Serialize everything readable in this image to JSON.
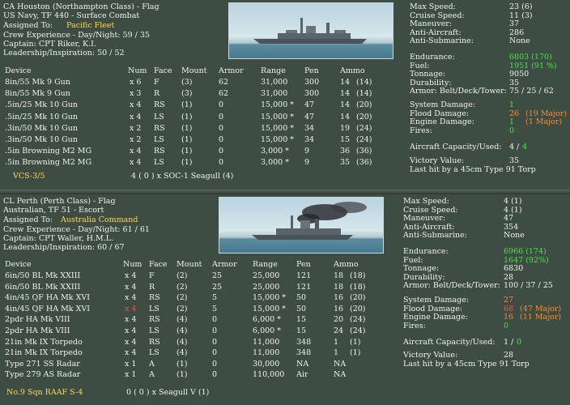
{
  "ship1": {
    "title": "CA Houston (Northampton Class) - Flag",
    "navy": "US Navy, TF 440 - Surface Combat",
    "assigned_label": "Assigned To:",
    "assigned_value": "Pacific Fleet",
    "crew": "Crew Experience - Day/Night:  59 / 35",
    "captain": "Captain:  CPT Riker, K.I.",
    "leadership": "Leadership/Inspiration: 50 / 52",
    "headers": [
      "Device",
      "Num",
      "Face",
      "Mount",
      "Armor",
      "Range",
      "Pen",
      "Ammo"
    ],
    "devices": [
      [
        "8in/55 Mk 9 Gun",
        "x 6",
        "F",
        "(3)",
        "62",
        "31,000",
        "300",
        "14",
        "(14)"
      ],
      [
        "8in/55 Mk 9 Gun",
        "x 3",
        "R",
        "(3)",
        "62",
        "31,000",
        "300",
        "14",
        "(14)"
      ],
      [
        ".5in/25 Mk 10 Gun",
        "x 4",
        "RS",
        "(1)",
        "0",
        "15,000 *",
        "47",
        "14",
        "(20)"
      ],
      [
        ".5in/25 Mk 10 Gun",
        "x 4",
        "LS",
        "(1)",
        "0",
        "15,000 *",
        "47",
        "14",
        "(20)"
      ],
      [
        ".3in/50 Mk 10 Gun",
        "x 2",
        "RS",
        "(1)",
        "0",
        "15,000 *",
        "34",
        "19",
        "(24)"
      ],
      [
        ".3in/50 Mk 10 Gun",
        "x 2",
        "LS",
        "(1)",
        "0",
        "15,000 *",
        "34",
        "15",
        "(24)"
      ],
      [
        ".5in Browning M2 MG",
        "x 4",
        "RS",
        "(1)",
        "0",
        "3,000 *",
        "9",
        "36",
        "(36)"
      ],
      [
        ".5in Browning M2 MG",
        "x 4",
        "LS",
        "(1)",
        "0",
        "3,000 *",
        "9",
        "35",
        "(36)"
      ]
    ],
    "air_unit": "VCS-3/5",
    "air_detail": "4 ( 0 ) x SOC-1 Seagull (4)",
    "stats": [
      {
        "label": "Max Speed:",
        "value": "23 (6)",
        "cls": ""
      },
      {
        "label": "Cruise Speed:",
        "value": "11 (3)",
        "cls": ""
      },
      {
        "label": "Maneuver:",
        "value": "37",
        "cls": ""
      },
      {
        "label": "Anti-Aircraft:",
        "value": "286",
        "cls": ""
      },
      {
        "label": "Anti-Submarine:",
        "value": "None",
        "cls": ""
      }
    ],
    "stats2": [
      {
        "label": "Endurance:",
        "value": "6803 (170)",
        "cls": "green"
      },
      {
        "label": "Fuel:",
        "value": "1951 (91 %)",
        "cls": "green"
      },
      {
        "label": "Tonnage:",
        "value": "9050",
        "cls": ""
      },
      {
        "label": "Durability:",
        "value": "35",
        "cls": ""
      },
      {
        "label": "Armor: Belt/Deck/Tower:",
        "value": "75 / 25 / 62",
        "cls": ""
      }
    ],
    "damage": [
      {
        "label": "System Damage:",
        "value": "1",
        "cls": "green",
        "extra": "",
        "extra_cls": ""
      },
      {
        "label": "Flood Damage:",
        "value": "26",
        "cls": "orange",
        "extra": "(19 Major)",
        "extra_cls": "orange"
      },
      {
        "label": "Engine Damage:",
        "value": "1",
        "cls": "green",
        "extra": "(1 Major)",
        "extra_cls": "orange"
      },
      {
        "label": "Fires:",
        "value": "0",
        "cls": "green",
        "extra": "",
        "extra_cls": ""
      }
    ],
    "aircraft_label": "Aircraft Capacity/Used:",
    "aircraft_value": "4 / ",
    "aircraft_used": "4",
    "victory_label": "Victory Value:",
    "victory_value": "35",
    "last_hit": "Last hit by a      45cm Type 91 Torp"
  },
  "ship2": {
    "title": "CL Perth (Perth Class) - Flag",
    "navy": "Australian, TF 51 - Escort",
    "assigned_label": "Assigned To:",
    "assigned_value": "Australia Command",
    "crew": "Crew Experience - Day/Night: 61 / 61",
    "captain": "Captain:  CPT Waller, H.M.L.",
    "leadership": "Leadership/Inspiration: 60 / 67",
    "headers": [
      "Device",
      "Num",
      "Face",
      "Mount",
      "Armor",
      "Range",
      "Pen",
      "Ammo"
    ],
    "devices": [
      [
        "6in/50 BL Mk XXIII",
        "x 4",
        "F",
        "(2)",
        "25",
        "25,000",
        "121",
        "18",
        "(18)"
      ],
      [
        "6in/50 BL Mk XXIII",
        "x 4",
        "R",
        "(2)",
        "25",
        "25,000",
        "121",
        "18",
        "(18)"
      ],
      [
        "4in/45 QF HA Mk XVI",
        "x 4",
        "RS",
        "(2)",
        "5",
        "15,000 *",
        "50",
        "16",
        "(20)"
      ],
      [
        "4in/45 QF HA Mk XVI",
        "x 4",
        "LS",
        "(2)",
        "5",
        "15,000 *",
        "50",
        "16",
        "(20)"
      ],
      [
        "2pdr HA Mk VIII",
        "x 4",
        "RS",
        "(4)",
        "0",
        "6,000 *",
        "15",
        "20",
        "(24)"
      ],
      [
        "2pdr HA Mk VIII",
        "x 4",
        "LS",
        "(4)",
        "0",
        "6,000 *",
        "15",
        "24",
        "(24)"
      ],
      [
        "21in Mk IX Torpedo",
        "x 4",
        "RS",
        "(4)",
        "0",
        "11,000",
        "348",
        "1",
        "(1)"
      ],
      [
        "21in Mk IX Torpedo",
        "x 4",
        "LS",
        "(4)",
        "0",
        "11,000",
        "348",
        "1",
        "(1)"
      ],
      [
        "Type 271 SS Radar",
        "x 1",
        "A",
        "(1)",
        "0",
        "30,000",
        "NA",
        "NA",
        ""
      ],
      [
        "Type 279 AS Radar",
        "x 1",
        "A",
        "(1)",
        "0",
        "110,000",
        "Air",
        "NA",
        ""
      ]
    ],
    "air_unit": "No.9 Sqn RAAF S-4",
    "air_detail": "0 ( 0 ) x Seagull V (1)",
    "stats": [
      {
        "label": "Max Speed:",
        "value": "4 (1)",
        "cls": ""
      },
      {
        "label": "Cruise Speed:",
        "value": "4 (1)",
        "cls": ""
      },
      {
        "label": "Maneuver:",
        "value": "47",
        "cls": ""
      },
      {
        "label": "Anti-Aircraft:",
        "value": "354",
        "cls": ""
      },
      {
        "label": "Anti-Submarine:",
        "value": "None",
        "cls": ""
      }
    ],
    "stats2": [
      {
        "label": "Endurance:",
        "value": "6966 (174)",
        "cls": "green"
      },
      {
        "label": "Fuel:",
        "value": "1647 (92%)",
        "cls": "green"
      },
      {
        "label": "Tonnage:",
        "value": "6830",
        "cls": ""
      },
      {
        "label": "Durability:",
        "value": "28",
        "cls": ""
      },
      {
        "label": "Armor: Belt/Deck/Tower:",
        "value": "100 / 37 / 25",
        "cls": ""
      }
    ],
    "damage": [
      {
        "label": "System Damage:",
        "value": "27",
        "cls": "orange",
        "extra": "",
        "extra_cls": ""
      },
      {
        "label": "Flood Damage:",
        "value": "68",
        "cls": "red",
        "extra": "(47 Major)",
        "extra_cls": "orange"
      },
      {
        "label": "Engine Damage:",
        "value": "16",
        "cls": "orange",
        "extra": "(11 Major)",
        "extra_cls": "orange"
      },
      {
        "label": "Fires:",
        "value": "0",
        "cls": "green",
        "extra": "",
        "extra_cls": ""
      }
    ],
    "aircraft_label": "Aircraft Capacity/Used:",
    "aircraft_value": "1 / ",
    "aircraft_used": "0",
    "victory_label": "Victory Value:",
    "victory_value": "28",
    "last_hit": "Last hit by a      45cm Type 91 Torp"
  }
}
